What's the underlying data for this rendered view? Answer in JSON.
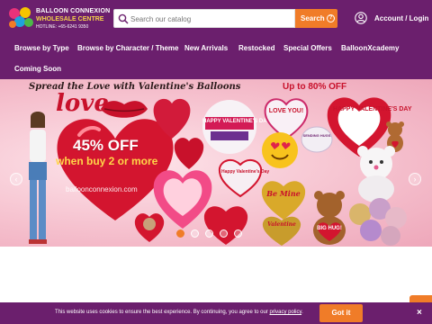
{
  "header": {
    "logo": {
      "title": "BALLOON CONNEXION",
      "subtitle": "WHOLESALE CENTRE",
      "hotline": "HOTLINE: +65-6241 9350"
    },
    "search": {
      "placeholder": "Search our catalog",
      "button_label": "Search"
    },
    "account_label": "Account / Login"
  },
  "nav": {
    "items": [
      {
        "label": "Browse by Type"
      },
      {
        "label": "Browse by Character / Theme"
      },
      {
        "label": "New Arrivals"
      },
      {
        "label": "Restocked"
      },
      {
        "label": "Special Offers"
      },
      {
        "label": "BalloonXcademy"
      },
      {
        "label": "Coming Soon"
      }
    ]
  },
  "banner": {
    "headline": "Spread the Love with Valentine's Balloons",
    "discount": "Up to 80% OFF",
    "love_script": "love",
    "offer_main": "45% OFF",
    "offer_sub": "when buy 2 or more",
    "site": "balloonconnexion.com",
    "balloon_texts": {
      "happy_valentines": "HAPPY VALENTINE'S DAY",
      "love_you": "LOVE YOU!",
      "happy_valentines_right": "HAPPY VALENTINE'S DAY",
      "be_mine": "Be Mine",
      "valentine": "Valentine",
      "big_hug": "BIG HUG!",
      "sending_hugs": "SENDING HUGS",
      "happy_vday_small": "Happy Valentine's Day"
    },
    "slide_count": 5,
    "active_slide": 1
  },
  "cookie": {
    "text_before": "This website uses cookies to ensure the best experience. By continuing, you agree to our",
    "link": "privacy policy",
    "text_after": ".",
    "button": "Got it",
    "close": "×"
  },
  "colors": {
    "brand_purple": "#6b1f6d",
    "accent_orange": "#f07c28",
    "banner_pink": "#f6c2cf",
    "balloon_red": "#c8112b"
  }
}
